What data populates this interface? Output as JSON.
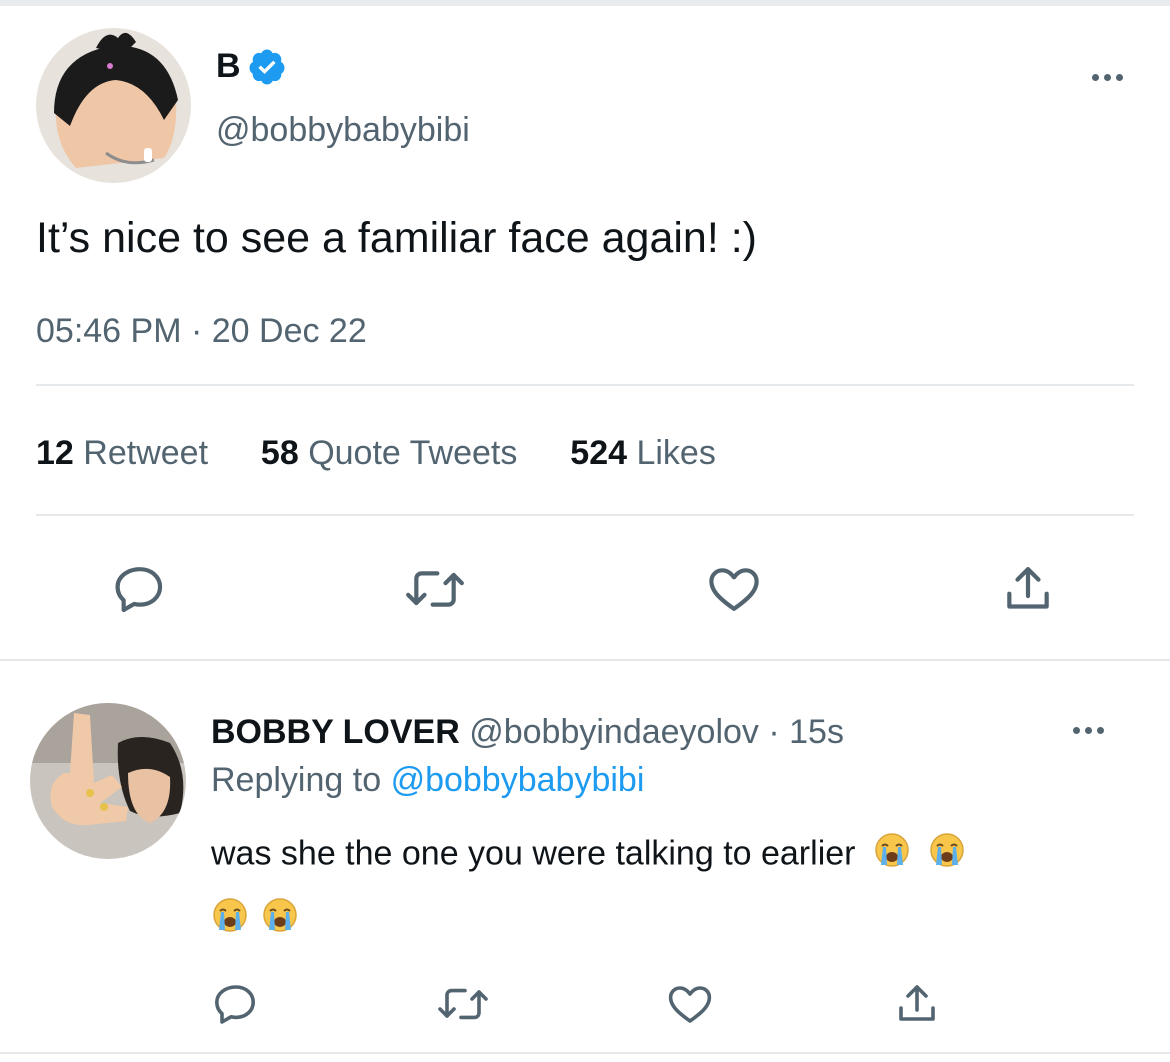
{
  "colors": {
    "link": "#1d9bf0",
    "verified": "#1d9bf0",
    "muted": "#536471",
    "text": "#0f1419"
  },
  "main_tweet": {
    "display_name": "B",
    "handle": "@bobbybabybibi",
    "text": "It’s nice to see a familiar face again! :)",
    "timestamp": "05:46 PM · 20 Dec 22",
    "stats": {
      "retweets_count": "12",
      "retweets_label": "Retweet",
      "quotes_count": "58",
      "quotes_label": "Quote Tweets",
      "likes_count": "524",
      "likes_label": "Likes"
    },
    "actions": [
      "reply-icon",
      "retweet-icon",
      "like-icon",
      "share-icon"
    ]
  },
  "reply": {
    "display_name": "BOBBY LOVER",
    "handle_time": "@bobbyindaeyolov · 15s",
    "replying_prefix": "Replying to",
    "replying_handle": "@bobbybabybibi",
    "text": "was she the one you were talking to earlier",
    "emoji": "loudly-crying-face",
    "emoji_count": 4,
    "actions": [
      "reply-icon",
      "retweet-icon",
      "like-icon",
      "share-icon"
    ]
  }
}
